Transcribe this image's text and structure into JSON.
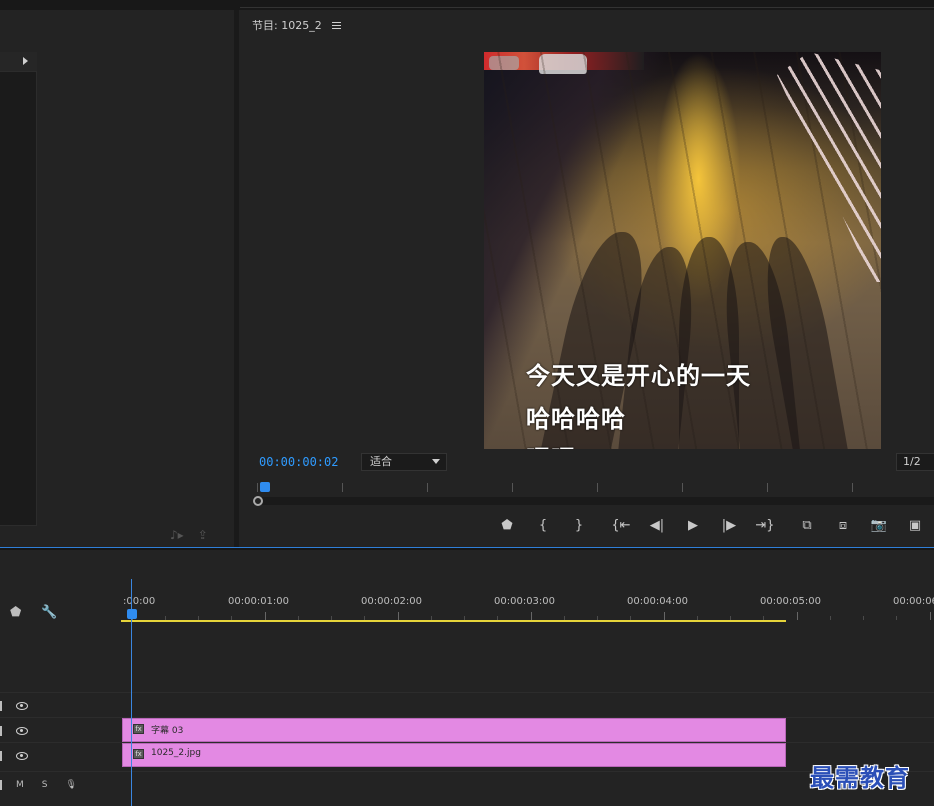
{
  "program_monitor": {
    "title": "节目: 1025_2",
    "timecode": "00:00:00:02",
    "fit_option": "适合",
    "resolution": "1/2",
    "captions": [
      "今天又是开心的一天",
      "哈哈哈哈",
      "嘿嘿"
    ]
  },
  "transport": [
    {
      "name": "add-marker-button",
      "glyph": "⬟"
    },
    {
      "name": "mark-in-button",
      "glyph": "{"
    },
    {
      "name": "mark-out-button",
      "glyph": "}"
    },
    {
      "name": "go-to-in-button",
      "glyph": "{⇤"
    },
    {
      "name": "step-back-button",
      "glyph": "◀|"
    },
    {
      "name": "play-button",
      "glyph": "▶"
    },
    {
      "name": "step-forward-button",
      "glyph": "|▶"
    },
    {
      "name": "go-to-out-button",
      "glyph": "⇥}"
    },
    {
      "name": "lift-button",
      "glyph": "⧉"
    },
    {
      "name": "extract-button",
      "glyph": "⧈"
    },
    {
      "name": "export-frame-button",
      "glyph": "📷"
    },
    {
      "name": "comparison-view-button",
      "glyph": "▣"
    }
  ],
  "timeline": {
    "ruler_labels": [
      ":00:00",
      "00:00:01:00",
      "00:00:02:00",
      "00:00:03:00",
      "00:00:04:00",
      "00:00:05:00",
      "00:00:06"
    ],
    "tracks": {
      "v3": {
        "clip": ""
      },
      "v2": {
        "clip": "字幕 03"
      },
      "v1": {
        "clip": "1025_2.jpg"
      },
      "a1": {
        "m": "M",
        "s": "S"
      }
    }
  },
  "watermark": "最需教育",
  "colors": {
    "accent": "#2f9bff",
    "clip": "#e389e3",
    "work_area": "#e6d43a"
  }
}
